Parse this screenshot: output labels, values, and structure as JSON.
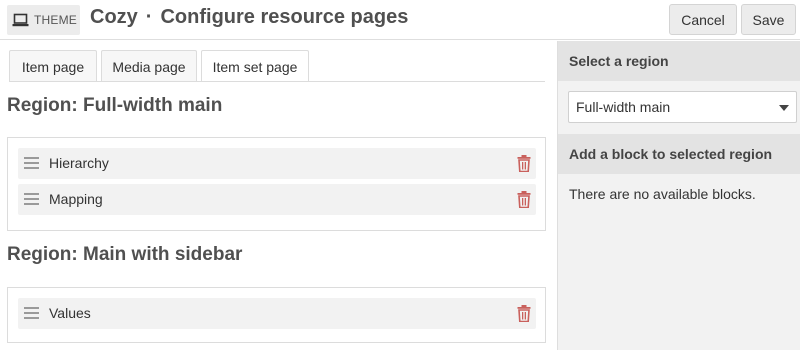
{
  "header": {
    "theme_badge": "THEME",
    "theme_icon": "laptop-icon",
    "theme_name": "Cozy",
    "separator": "·",
    "page_title": "Configure resource pages",
    "cancel_label": "Cancel",
    "save_label": "Save"
  },
  "tabs": [
    {
      "label": "Item page",
      "active": false
    },
    {
      "label": "Media page",
      "active": false
    },
    {
      "label": "Item set page",
      "active": true
    }
  ],
  "regions": [
    {
      "title": "Region: Full-width main",
      "blocks": [
        {
          "label": "Hierarchy"
        },
        {
          "label": "Mapping"
        }
      ]
    },
    {
      "title": "Region: Main with sidebar",
      "blocks": [
        {
          "label": "Values"
        }
      ]
    }
  ],
  "sidebar": {
    "select_region_heading": "Select a region",
    "selected_region": "Full-width main",
    "add_block_heading": "Add a block to selected region",
    "empty_message": "There are no available blocks."
  },
  "colors": {
    "trash": "#c9605c",
    "header_bg": "#ececec",
    "sidebar_bg": "#f2f2f2",
    "sidebar_heading_bg": "#e3e3e3"
  }
}
